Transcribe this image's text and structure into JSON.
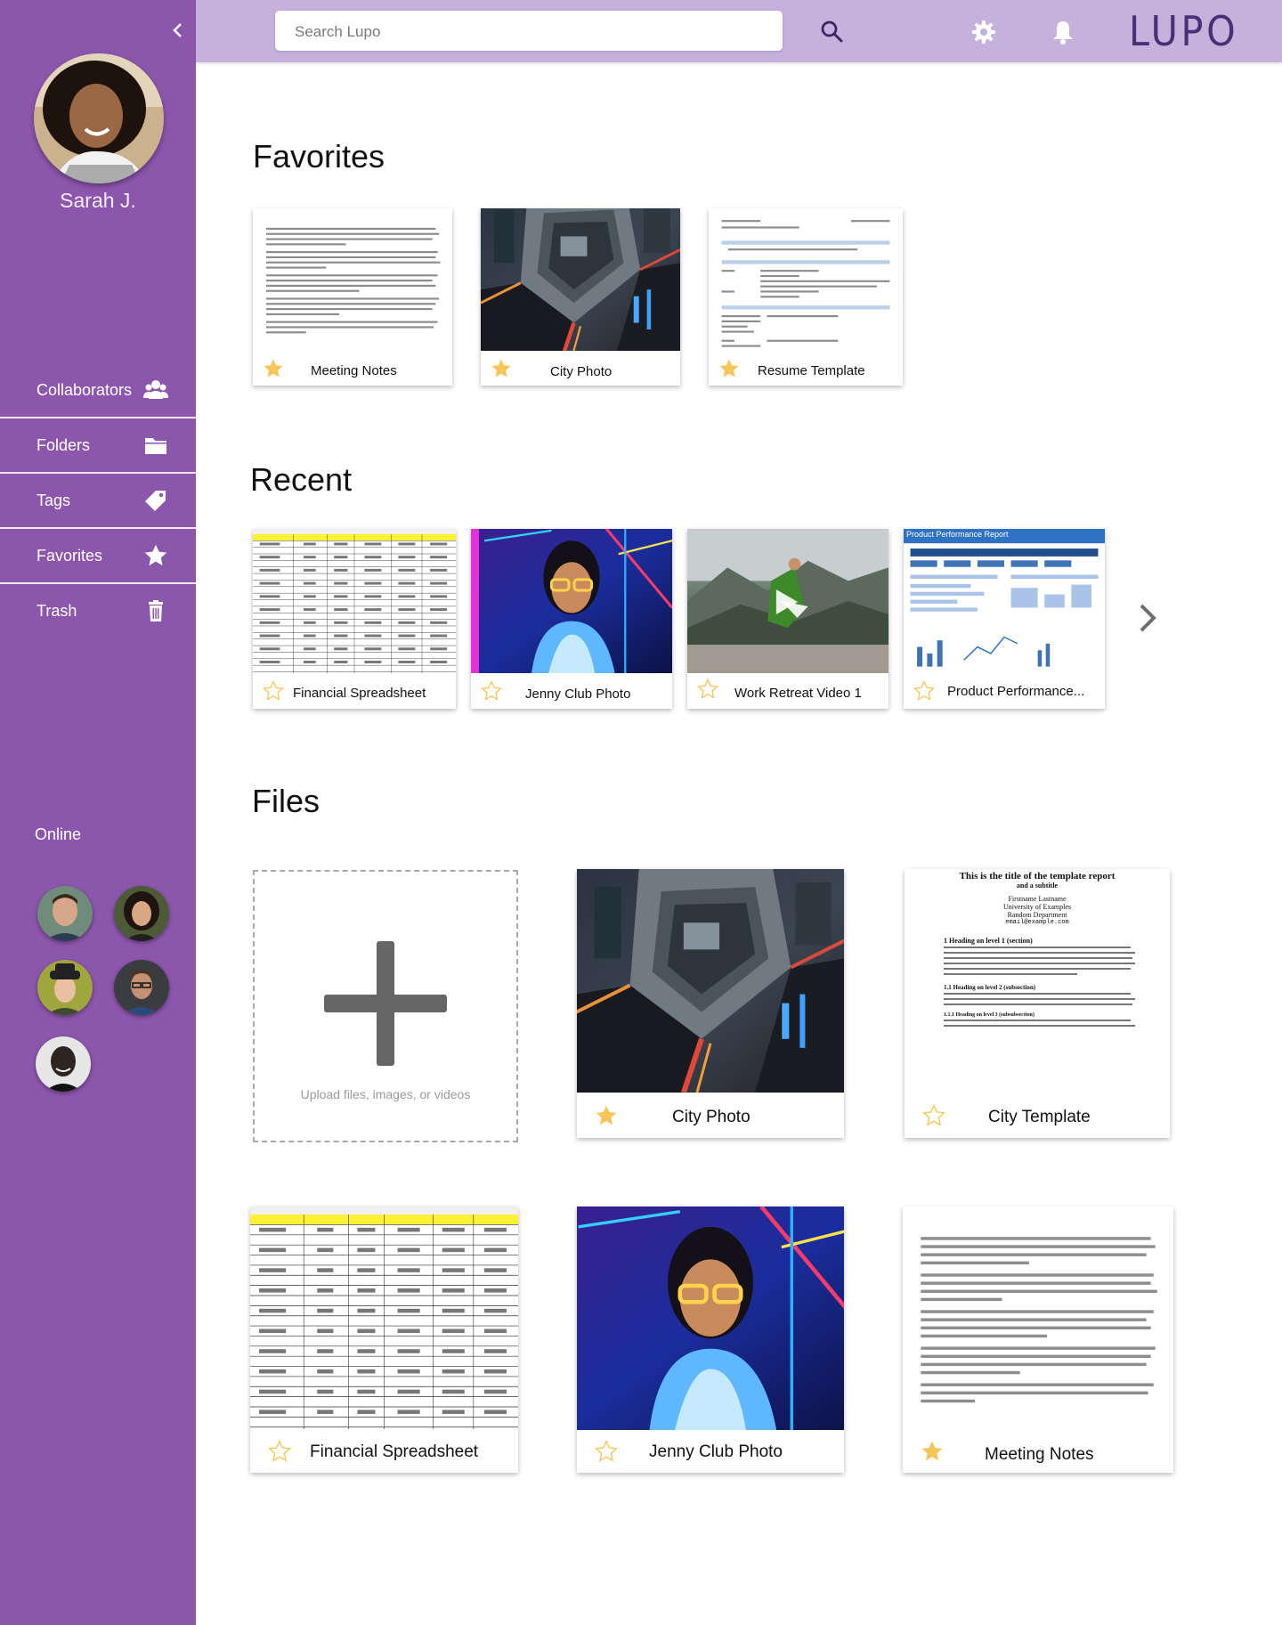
{
  "sidebar": {
    "username": "Sarah J.",
    "nav": [
      {
        "label": "Collaborators",
        "icon": "users-icon"
      },
      {
        "label": "Folders",
        "icon": "folder-icon"
      },
      {
        "label": "Tags",
        "icon": "tag-icon"
      },
      {
        "label": "Favorites",
        "icon": "star-icon"
      },
      {
        "label": "Trash",
        "icon": "trash-icon"
      }
    ],
    "online_label": "Online",
    "online_users": 5
  },
  "topbar": {
    "search_placeholder": "Search Lupo",
    "logo": "LUPO"
  },
  "sections": {
    "favorites": "Favorites",
    "recent": "Recent",
    "files": "Files"
  },
  "favorites": [
    {
      "title": "Meeting Notes",
      "starred": true,
      "type": "document"
    },
    {
      "title": "City Photo",
      "starred": true,
      "type": "photo"
    },
    {
      "title": "Resume Template",
      "starred": true,
      "type": "document"
    }
  ],
  "recent": [
    {
      "title": "Financial Spreadsheet",
      "starred": false,
      "type": "spreadsheet"
    },
    {
      "title": "Jenny Club Photo",
      "starred": false,
      "type": "photo"
    },
    {
      "title": "Work Retreat Video 1",
      "starred": false,
      "type": "video"
    },
    {
      "title": "Product Performance...",
      "starred": false,
      "type": "report"
    }
  ],
  "files": {
    "upload_hint": "Upload files, images, or videos",
    "items": [
      {
        "title": "City Photo",
        "starred": true,
        "type": "photo"
      },
      {
        "title": "City Template",
        "starred": false,
        "type": "document"
      },
      {
        "title": "Financial Spreadsheet",
        "starred": false,
        "type": "spreadsheet"
      },
      {
        "title": "Jenny Club Photo",
        "starred": false,
        "type": "photo"
      },
      {
        "title": "Meeting Notes",
        "starred": true,
        "type": "document"
      }
    ]
  },
  "thumbnail_text": {
    "city_template_title": "This is the title of the template report",
    "city_template_subtitle": "and a subtitle",
    "city_template_author": "Firstname Lastname",
    "city_template_university": "University of Examples",
    "city_template_department": "Random Department",
    "city_template_email": "email@example.com",
    "city_template_h1": "1  Heading on level 1 (section)",
    "city_template_h2": "1.1  Heading on level 2 (subsection)",
    "city_template_h3": "1.1.1  Heading on level 3 (subsubsection)",
    "report_header": "Product Performance Report",
    "resume_name": "[Your Name]",
    "resume_position": "[Applied Position]"
  },
  "colors": {
    "sidebar": "#8c56ac",
    "topbar": "#c5b1dc",
    "logo": "#4b2f74",
    "star": "#f7c65a"
  }
}
